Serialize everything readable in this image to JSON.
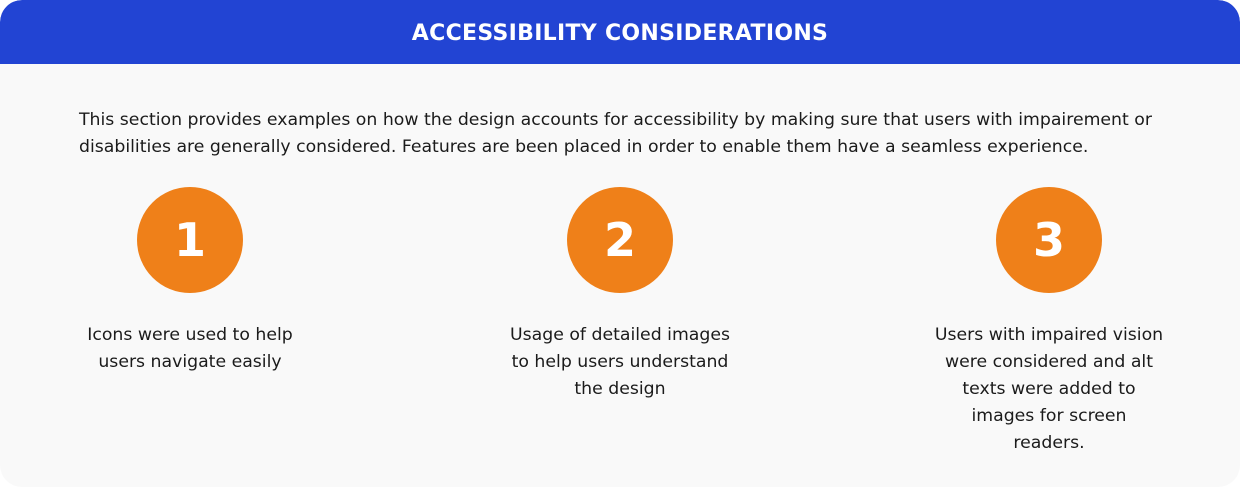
{
  "header": {
    "title": "ACCESSIBILITY CONSIDERATIONS"
  },
  "intro": {
    "text": "This section provides examples on how the design accounts for accessibility by making sure that users with impairement or disabilities are generally considered. Features are been placed in order to enable them have a seamless experience."
  },
  "features": [
    {
      "number": "1",
      "text": "Icons were used to help users navigate easily"
    },
    {
      "number": "2",
      "text": "Usage of detailed images to help users understand the design"
    },
    {
      "number": "3",
      "text": "Users with impaired vision were considered and alt texts were added to images for screen readers."
    }
  ],
  "colors": {
    "header_bg": "#2244d3",
    "circle_bg": "#ef8019",
    "card_bg": "#f9f9f9",
    "text": "#1b1b1b"
  }
}
